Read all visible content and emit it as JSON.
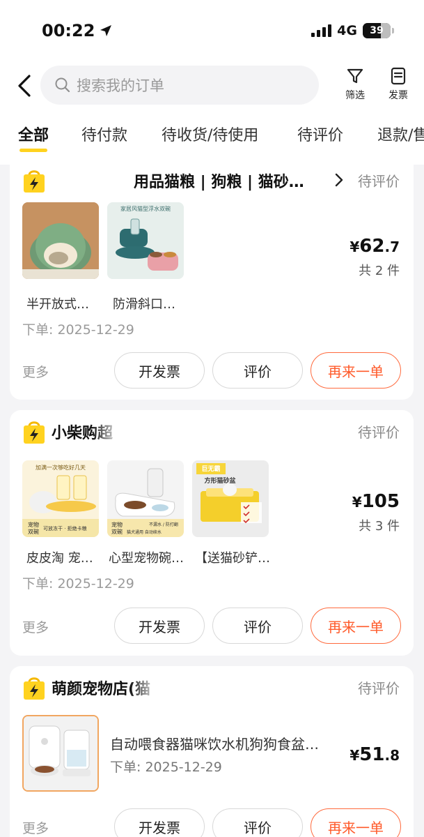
{
  "status_bar": {
    "time": "00:22",
    "network": "4G",
    "battery": "39"
  },
  "search": {
    "placeholder": "搜索我的订单"
  },
  "toolbar": {
    "filter_label": "筛选",
    "invoice_label": "发票"
  },
  "tabs": [
    "全部",
    "待付款",
    "待收货/待使用",
    "待评价",
    "退款/售"
  ],
  "orders": [
    {
      "shop_name": "用品猫粮 | 狗粮 | 猫砂…",
      "status": "待评价",
      "items": [
        {
          "label": "半开放式…"
        },
        {
          "label": "防滑斜口…"
        }
      ],
      "price_symbol": "¥",
      "price_int": "62",
      "price_dec": ".7",
      "count": "共 2 件",
      "date": "下单: 2025-12-29",
      "more": "更多",
      "buttons": {
        "invoice": "开发票",
        "review": "评价",
        "reorder": "再来一单"
      }
    },
    {
      "shop_name": "小柴购超",
      "status": "待评价",
      "items": [
        {
          "label": "皮皮淘 宠…"
        },
        {
          "label": "心型宠物碗…"
        },
        {
          "label": "【送猫砂铲…"
        }
      ],
      "price_symbol": "¥",
      "price_int": "105",
      "price_dec": "",
      "count": "共 3 件",
      "date": "下单: 2025-12-29",
      "more": "更多",
      "buttons": {
        "invoice": "开发票",
        "review": "评价",
        "reorder": "再来一单"
      }
    },
    {
      "shop_name": "萌颜宠物店(猫",
      "status": "待评价",
      "items": [
        {
          "title": "自动喂食器猫咪饮水机狗狗食盆…"
        }
      ],
      "price_symbol": "¥",
      "price_int": "51",
      "price_dec": ".8",
      "date": "下单: 2025-12-29",
      "more": "更多",
      "buttons": {
        "invoice": "开发票",
        "review": "评价",
        "reorder": "再来一单"
      }
    }
  ],
  "thumb_texts": {
    "o2i1_line1": "加满一次够吃好几天",
    "o2i1_tag1": "宠物",
    "o2i1_tag2": "双碗",
    "o2i1_sub": "可放冻干 · 拒绝卡粮",
    "o2i2_tag1": "宠物",
    "o2i2_tag2": "双碗",
    "o2i2_sub1": "不漏水 / 防打翻",
    "o2i2_sub2": "猫犬通用  自动续水",
    "o2i3_line1": "巨无霸",
    "o2i3_line2": "方形猫砂盆",
    "o1i2_line1": "家居风猫型浮水双碗"
  },
  "colors": {
    "accent_yellow": "#ffd21f",
    "reorder_orange": "#ff5a2a"
  },
  "icons": [
    "location-arrow-icon",
    "signal-icon",
    "battery-icon",
    "back-arrow-icon",
    "search-icon",
    "filter-icon",
    "invoice-icon",
    "shop-bag-icon",
    "chevron-right-icon"
  ]
}
